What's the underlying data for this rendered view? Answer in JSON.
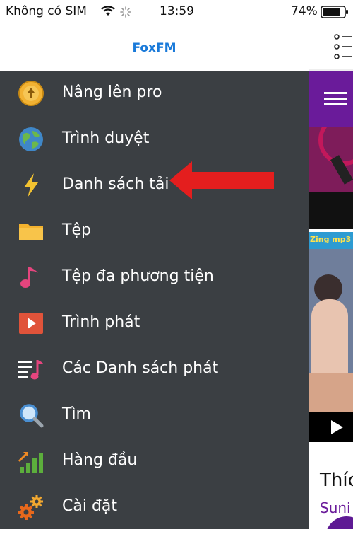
{
  "status_bar": {
    "carrier": "Không có SIM",
    "time": "13:59",
    "battery": "74%"
  },
  "drawer": {
    "title": "FoxFM",
    "items": [
      {
        "label": "Nâng lên pro",
        "icon": "upgrade-pro-icon"
      },
      {
        "label": "Trình duyệt",
        "icon": "globe-icon"
      },
      {
        "label": "Danh sách tải",
        "icon": "lightning-icon"
      },
      {
        "label": "Tệp",
        "icon": "folder-icon"
      },
      {
        "label": "Tệp đa phương tiện",
        "icon": "music-note-icon"
      },
      {
        "label": "Trình phát",
        "icon": "play-icon"
      },
      {
        "label": "Các Danh sách phát",
        "icon": "playlist-icon"
      },
      {
        "label": "Tìm",
        "icon": "search-icon"
      },
      {
        "label": "Hàng đầu",
        "icon": "top-chart-icon"
      },
      {
        "label": "Cài đặt",
        "icon": "settings-gears-icon"
      }
    ]
  },
  "right_panel": {
    "thumb_text": "Zing mp3",
    "title_partial": "Thíc",
    "subtitle_partial": "Suni"
  },
  "colors": {
    "drawer_bg": "#3b3f43",
    "title": "#1a7ad9",
    "purple": "#6a1b9a",
    "arrow": "#e41e1e"
  }
}
